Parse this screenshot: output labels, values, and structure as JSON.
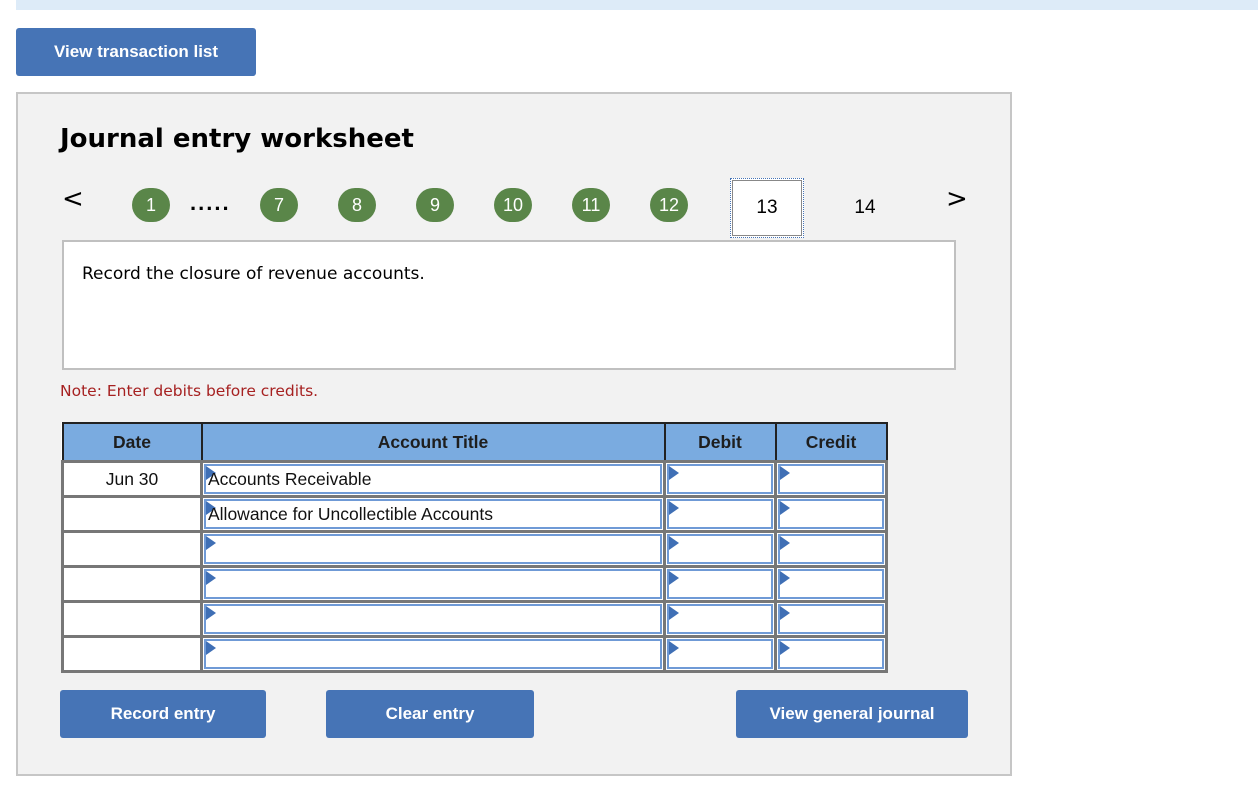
{
  "toolbar": {
    "view_transaction_list_label": "View transaction list"
  },
  "worksheet": {
    "title": "Journal entry worksheet",
    "nav": {
      "prev_icon": "chevron-left-icon",
      "next_icon": "chevron-right-icon",
      "prev_glyph": "<",
      "next_glyph": ">",
      "ellipsis": ".....",
      "completed_steps": [
        "1",
        "7",
        "8",
        "9",
        "10",
        "11",
        "12"
      ],
      "current_step": "13",
      "next_steps": [
        "14"
      ],
      "completed_color": "#5a8649"
    },
    "prompt": "Record the closure of revenue accounts.",
    "note": "Note: Enter debits before credits.",
    "note_color": "#a62121",
    "table": {
      "headers": {
        "date": "Date",
        "account": "Account Title",
        "debit": "Debit",
        "credit": "Credit"
      },
      "rows": [
        {
          "date": "Jun 30",
          "account": "Accounts Receivable",
          "debit": "",
          "credit": ""
        },
        {
          "date": "",
          "account": "Allowance for Uncollectible Accounts",
          "debit": "",
          "credit": ""
        },
        {
          "date": "",
          "account": "",
          "debit": "",
          "credit": ""
        },
        {
          "date": "",
          "account": "",
          "debit": "",
          "credit": ""
        },
        {
          "date": "",
          "account": "",
          "debit": "",
          "credit": ""
        },
        {
          "date": "",
          "account": "",
          "debit": "",
          "credit": ""
        }
      ]
    },
    "buttons": {
      "record": "Record entry",
      "clear": "Clear entry",
      "view_general_journal": "View general journal"
    }
  },
  "colors": {
    "button_blue": "#4674b6",
    "header_blue": "#7aabe0",
    "panel_bg": "#f2f2f2",
    "top_bar": "#ddebf8"
  }
}
